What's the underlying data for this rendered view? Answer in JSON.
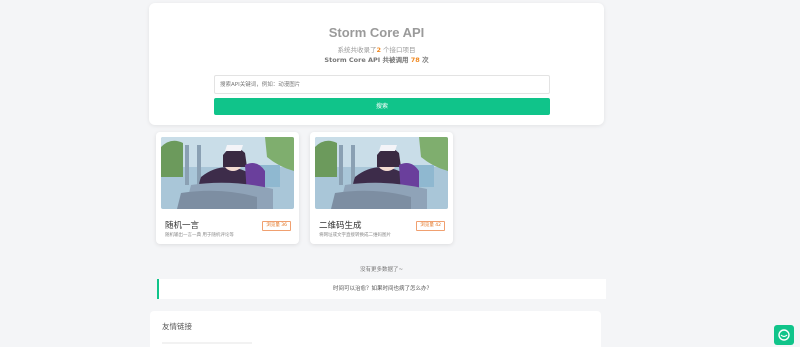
{
  "hero": {
    "title": "Storm Core API",
    "sub_prefix": "系统共收录了",
    "api_count": "2",
    "sub_suffix": "个接口项目",
    "calls_prefix": "Storm Core API 共被调用",
    "call_count": "78",
    "calls_suffix": "次"
  },
  "search": {
    "placeholder": "搜索API关键词，例如：动漫图片",
    "button_label": "搜索"
  },
  "cards": [
    {
      "title": "随机一言",
      "desc": "随机输出一言一典 用于随机评论等",
      "views": "浏览量 36"
    },
    {
      "title": "二维码生成",
      "desc": "将网址或文字直接转换成二维码图片",
      "views": "浏览量 42"
    }
  ],
  "no_more": "没有更多数据了~",
  "notice": "时间可以治愈？如果时间也病了怎么办？",
  "friends": {
    "title": "友情链接"
  },
  "colors": {
    "accent": "#10c48a",
    "number": "#f08a24"
  },
  "icons": {
    "float_button": "chat-icon"
  }
}
